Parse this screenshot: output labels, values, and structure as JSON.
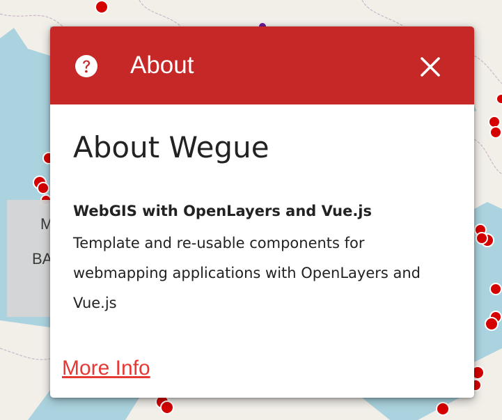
{
  "dialog": {
    "title": "About",
    "icon": "help-circle-icon",
    "close_icon": "close-icon",
    "header_color": "#c62828"
  },
  "content": {
    "heading": "About Wegue",
    "subtitle": "WebGIS with OpenLayers and Vue.js",
    "body": "Template and re-usable components for webmapping applications with OpenLayers and Vue.js",
    "more_info": "More Info",
    "link_color": "#e53935"
  },
  "background_panel": {
    "line1": "M",
    "line2": "BA"
  },
  "map": {
    "water_color": "#aad3df",
    "land_color": "#f2efe9",
    "marker_color": "#d50000"
  }
}
